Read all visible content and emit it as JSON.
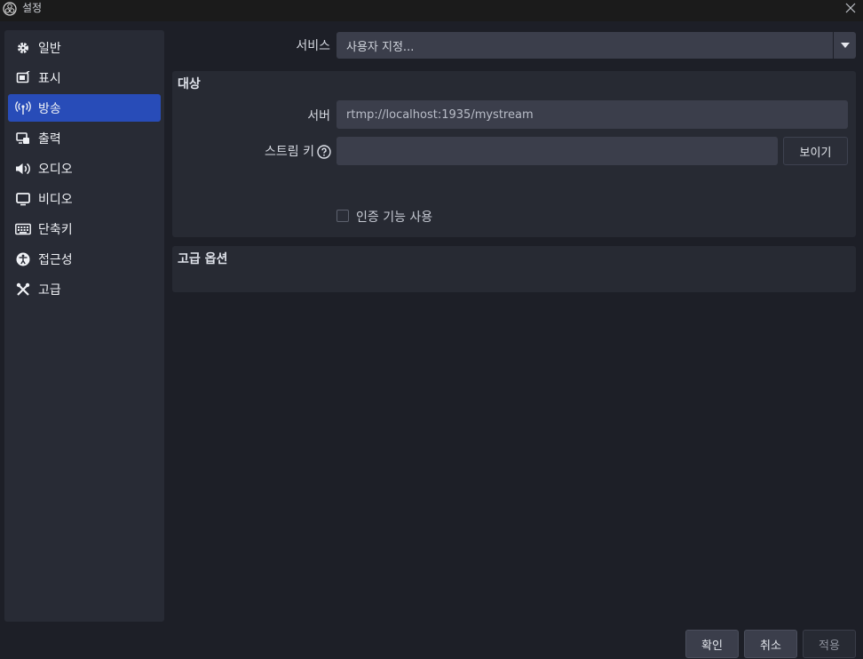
{
  "window": {
    "title": "설정"
  },
  "sidebar": {
    "items": [
      {
        "label": "일반",
        "icon": "gear-icon"
      },
      {
        "label": "표시",
        "icon": "display-icon"
      },
      {
        "label": "방송",
        "icon": "broadcast-icon",
        "active": true
      },
      {
        "label": "출력",
        "icon": "output-icon"
      },
      {
        "label": "오디오",
        "icon": "speaker-icon"
      },
      {
        "label": "비디오",
        "icon": "monitor-icon"
      },
      {
        "label": "단축키",
        "icon": "keyboard-icon"
      },
      {
        "label": "접근성",
        "icon": "accessibility-icon"
      },
      {
        "label": "고급",
        "icon": "tools-icon"
      }
    ]
  },
  "stream": {
    "service_label": "서비스",
    "service_value": "사용자 지정...",
    "destination_title": "대상",
    "server_label": "서버",
    "server_value": "rtmp://localhost:1935/mystream",
    "stream_key_label": "스트림 키",
    "stream_key_value": "",
    "show_button": "보이기",
    "auth_label": "인증 기능 사용",
    "auth_checked": false,
    "advanced_title": "고급 옵션"
  },
  "footer": {
    "ok": "확인",
    "cancel": "취소",
    "apply": "적용"
  },
  "colors": {
    "accent": "#284cb8",
    "background": "#1d1f27",
    "panel": "#282b35",
    "input": "#3b3e4b"
  }
}
